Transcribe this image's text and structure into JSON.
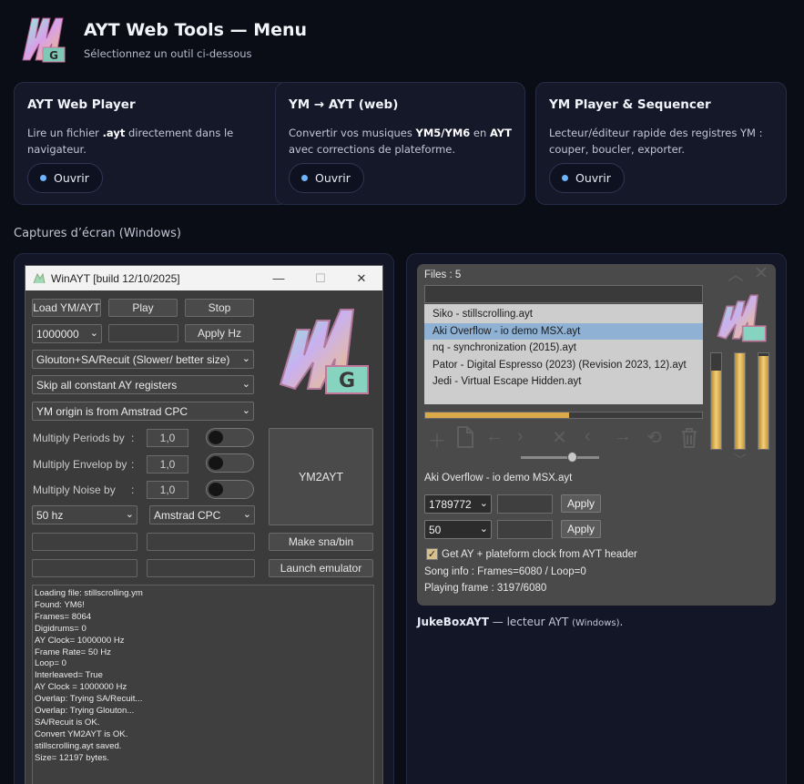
{
  "header": {
    "title": "AYT Web Tools — Menu",
    "subtitle": "Sélectionnez un outil ci-dessous",
    "logo_text": "AYT"
  },
  "cards": [
    {
      "title": "AYT Web Player",
      "desc_parts": [
        "Lire un fichier ",
        ".ayt",
        " directement dans le navigateur."
      ],
      "button": "Ouvrir"
    },
    {
      "title": "YM → AYT (web)",
      "desc_parts": [
        "Convertir vos musiques ",
        "YM5/YM6",
        " en ",
        "AYT",
        " avec corrections de plateforme."
      ],
      "button": "Ouvrir"
    },
    {
      "title": "YM Player & Sequencer",
      "desc": "Lecteur/éditeur rapide des registres YM : couper, boucler, exporter.",
      "button": "Ouvrir"
    }
  ],
  "screenshots_title": "Captures d’écran (Windows)",
  "winayt": {
    "window_title": "WinAYT [build 12/10/2025]",
    "controls": {
      "minimize": "—",
      "maximize": "☐",
      "close": "✕"
    },
    "buttons": {
      "load": "Load YM/AYT",
      "play": "Play",
      "stop": "Stop",
      "apply_hz": "Apply Hz",
      "ym2ayt": "YM2AYT",
      "make_sna": "Make sna/bin",
      "launch": "Launch emulator"
    },
    "freq_select": "1000000",
    "algo_select": "Glouton+SA/Recuit (Slower/ better size)",
    "ay_select": "Skip all constant AY registers",
    "origin_select": "YM origin is from Amstrad CPC",
    "multiply": [
      {
        "label": "Multiply Periods by",
        "colon": ":",
        "value": "1,0"
      },
      {
        "label": "Multiply Envelop by",
        "colon": ":",
        "value": "1,0"
      },
      {
        "label": "Multiply Noise by",
        "colon": ":",
        "value": "1,0"
      }
    ],
    "hz_select": "50 hz",
    "platform_select": "Amstrad CPC",
    "log": [
      "Loading file: stillscrolling.ym",
      "Found: YM6!",
      "Frames= 8064",
      "Digidrums= 0",
      "AY Clock= 1000000 Hz",
      "Frame Rate= 50 Hz",
      "Loop= 0",
      "Interleaved= True",
      "AY Clock = 1000000 Hz",
      "Overlap: Trying SA/Recuit...",
      "Overlap: Trying Glouton...",
      "SA/Recuit is OK.",
      "Convert YM2AYT is OK.",
      "stillscrolling.ayt saved.",
      "Size= 12197 bytes."
    ]
  },
  "jukebox": {
    "files_label": "Files : 5",
    "files": [
      "Siko - stillscrolling.ayt",
      "Aki Overflow - io demo MSX.ayt",
      "nq - synchronization (2015).ayt",
      "Pator - Digital Espresso (2023) (Revision 2023, 12).ayt",
      "Jedi - Virtual Escape Hidden.ayt"
    ],
    "selected_index": 1,
    "progress": 0.52,
    "volume": 0.45,
    "vu_levels": [
      0.82,
      1.0,
      0.97
    ],
    "current_track": "Aki Overflow - io demo MSX.ayt",
    "clock_select": "1789772",
    "rate_select": "50",
    "apply_label": "Apply",
    "checkbox_label": "Get AY + plateform clock from AYT header",
    "checkbox_checked": true,
    "song_info": "Song info : Frames=6080 / Loop=0",
    "playing_frame": "Playing frame : 3197/6080"
  },
  "caption": {
    "name": "JukeBoxAYT",
    "text": " — lecteur AYT ",
    "small": "(Windows)",
    "end": "."
  },
  "colors": {
    "background": "#0b0d16",
    "card": "#141829",
    "accent_dot": "#6fb4ff",
    "progress": "#d9a94a"
  }
}
